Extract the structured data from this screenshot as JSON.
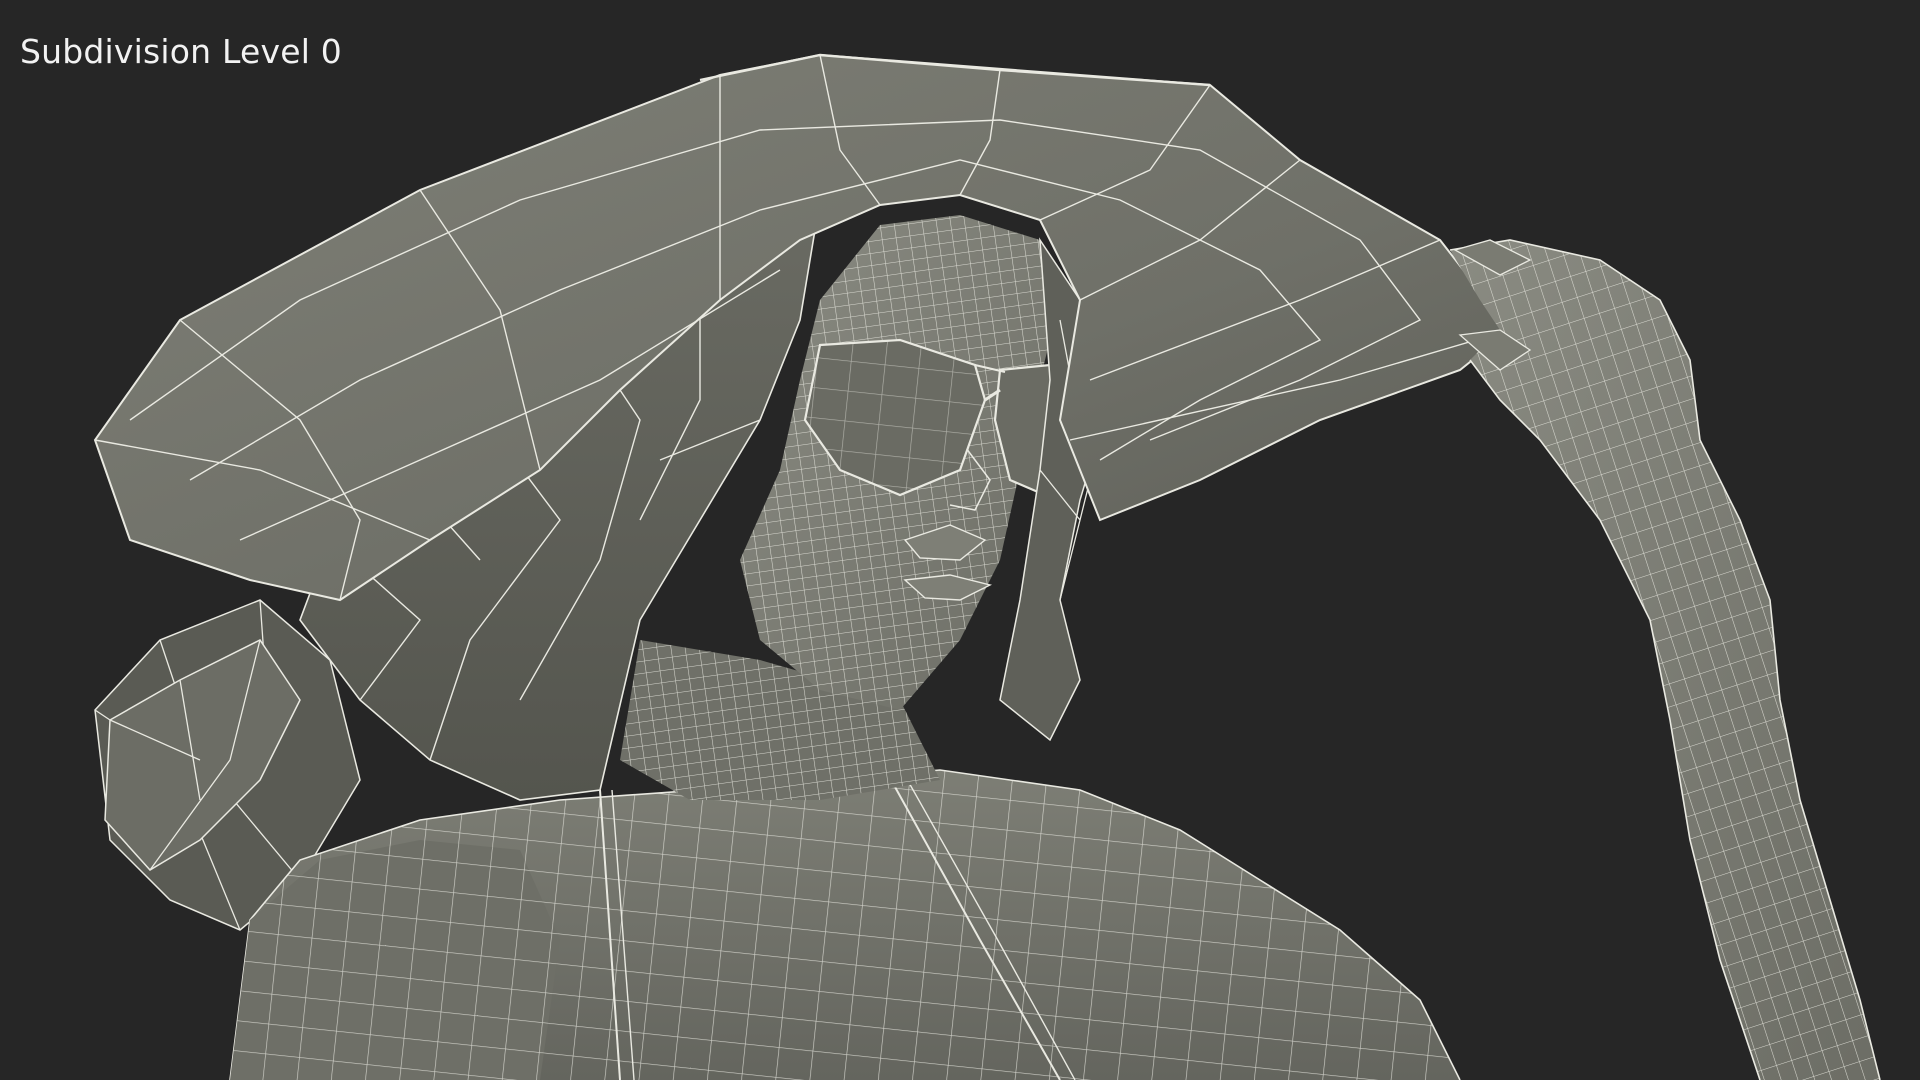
{
  "overlay": {
    "label": "Subdivision Level 0"
  },
  "scene": {
    "subject": "wireframe-3d-model-woman-wide-brim-hat-sunglasses",
    "background_color": "#262626",
    "mesh_fill_color": "#7a7b72",
    "mesh_shadow_color": "#4e4f49",
    "wire_color": "#e9e9e1"
  }
}
